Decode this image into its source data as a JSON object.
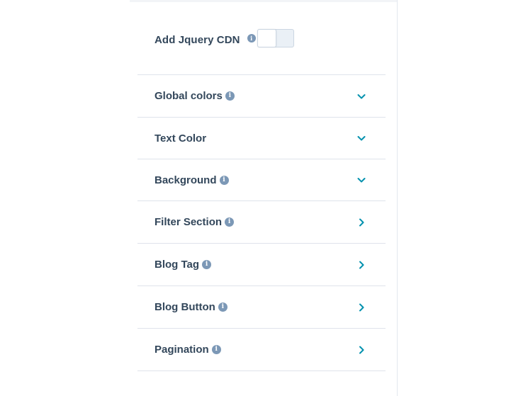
{
  "toggle": {
    "label": "Add Jquery CDN",
    "info_glyph": "i",
    "enabled": false
  },
  "sections": [
    {
      "label": "Global colors",
      "has_info": true,
      "state": "collapsed-down",
      "icon": "chevron-down-icon"
    },
    {
      "label": "Text Color",
      "has_info": false,
      "state": "collapsed-down",
      "icon": "chevron-down-icon"
    },
    {
      "label": "Background",
      "has_info": true,
      "state": "collapsed-down",
      "icon": "chevron-down-icon"
    },
    {
      "label": "Filter Section",
      "has_info": true,
      "state": "collapsed-right",
      "icon": "chevron-right-icon"
    },
    {
      "label": "Blog Tag",
      "has_info": true,
      "state": "collapsed-right",
      "icon": "chevron-right-icon"
    },
    {
      "label": "Blog Button",
      "has_info": true,
      "state": "collapsed-right",
      "icon": "chevron-right-icon"
    },
    {
      "label": "Pagination",
      "has_info": true,
      "state": "collapsed-right",
      "icon": "chevron-right-icon"
    }
  ],
  "colors": {
    "label_text": "#33475b",
    "info_icon": "#7c98b6",
    "chevron": "#0091ae",
    "divider": "#dfe3eb",
    "toggle_track": "#eaf0f6"
  }
}
